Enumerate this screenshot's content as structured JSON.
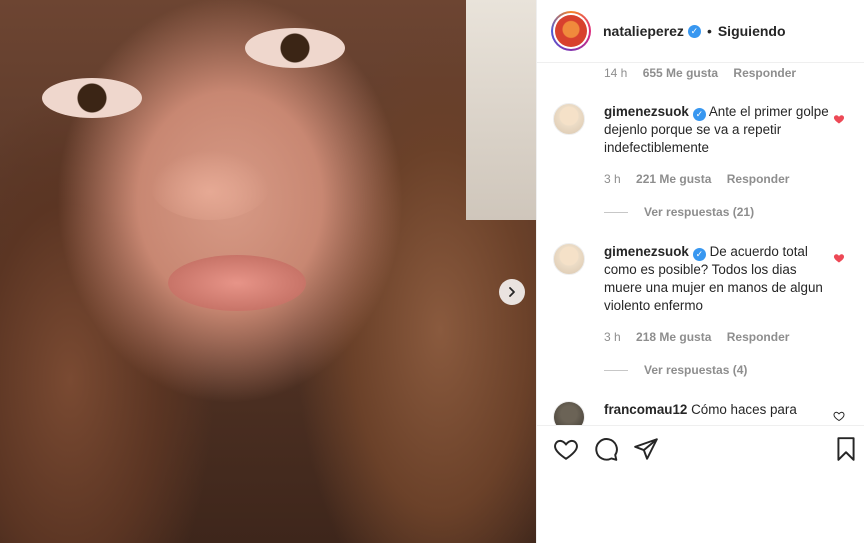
{
  "header": {
    "username": "natalieperez",
    "separator": "•",
    "follow_status": "Siguiendo"
  },
  "top_meta": {
    "time": "14 h",
    "likes": "655 Me gusta",
    "reply": "Responder"
  },
  "comments": [
    {
      "username": "gimenezsuok",
      "text": "Ante el primer golpe dejenlo porque se va a repetir indefectiblemente",
      "time": "3 h",
      "likes": "221 Me gusta",
      "reply": "Responder",
      "view_replies": "Ver respuestas (21)",
      "liked": true
    },
    {
      "username": "gimenezsuok",
      "text": "De acuerdo total como es posible? Todos los dias muere una mujer en manos de algun violento enfermo",
      "time": "3 h",
      "likes": "218 Me gusta",
      "reply": "Responder",
      "view_replies": "Ver respuestas (4)",
      "liked": true
    },
    {
      "username": "francomau12",
      "text": "Cómo haces para",
      "liked": false
    }
  ],
  "icons": {
    "like": "heart-outline-icon",
    "comment": "speech-bubble-icon",
    "share": "paper-plane-icon",
    "save": "bookmark-icon",
    "next": "chevron-right-icon",
    "verified": "verified-badge-icon"
  },
  "colors": {
    "liked_heart": "#ed4956",
    "verified": "#3897f0",
    "muted_text": "#8e8e8e"
  }
}
